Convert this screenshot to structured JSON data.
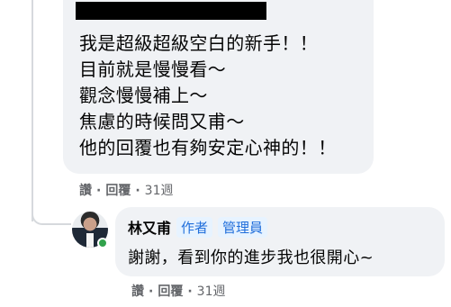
{
  "comment": {
    "lines": [
      "我是超級超級空白的新手！！",
      "目前就是慢慢看～",
      "觀念慢慢補上～",
      "焦慮的時候問又甫～",
      "他的回覆也有夠安定心神的！！"
    ],
    "actions": {
      "like": "讚",
      "reply": "回覆",
      "separator": "·",
      "time": "31週"
    }
  },
  "reply": {
    "author": "林又甫",
    "badges": [
      "作者",
      "管理員"
    ],
    "text": "謝謝，看到你的進步我也很開心~",
    "actions": {
      "like": "讚",
      "reply": "回覆",
      "separator": "·",
      "time": "31週"
    }
  },
  "colors": {
    "bubble_bg": "#f0f2f5",
    "badge_text": "#216fdb",
    "badge_bg": "#e7f3ff",
    "muted_text": "#65676b",
    "online": "#31a24c"
  }
}
